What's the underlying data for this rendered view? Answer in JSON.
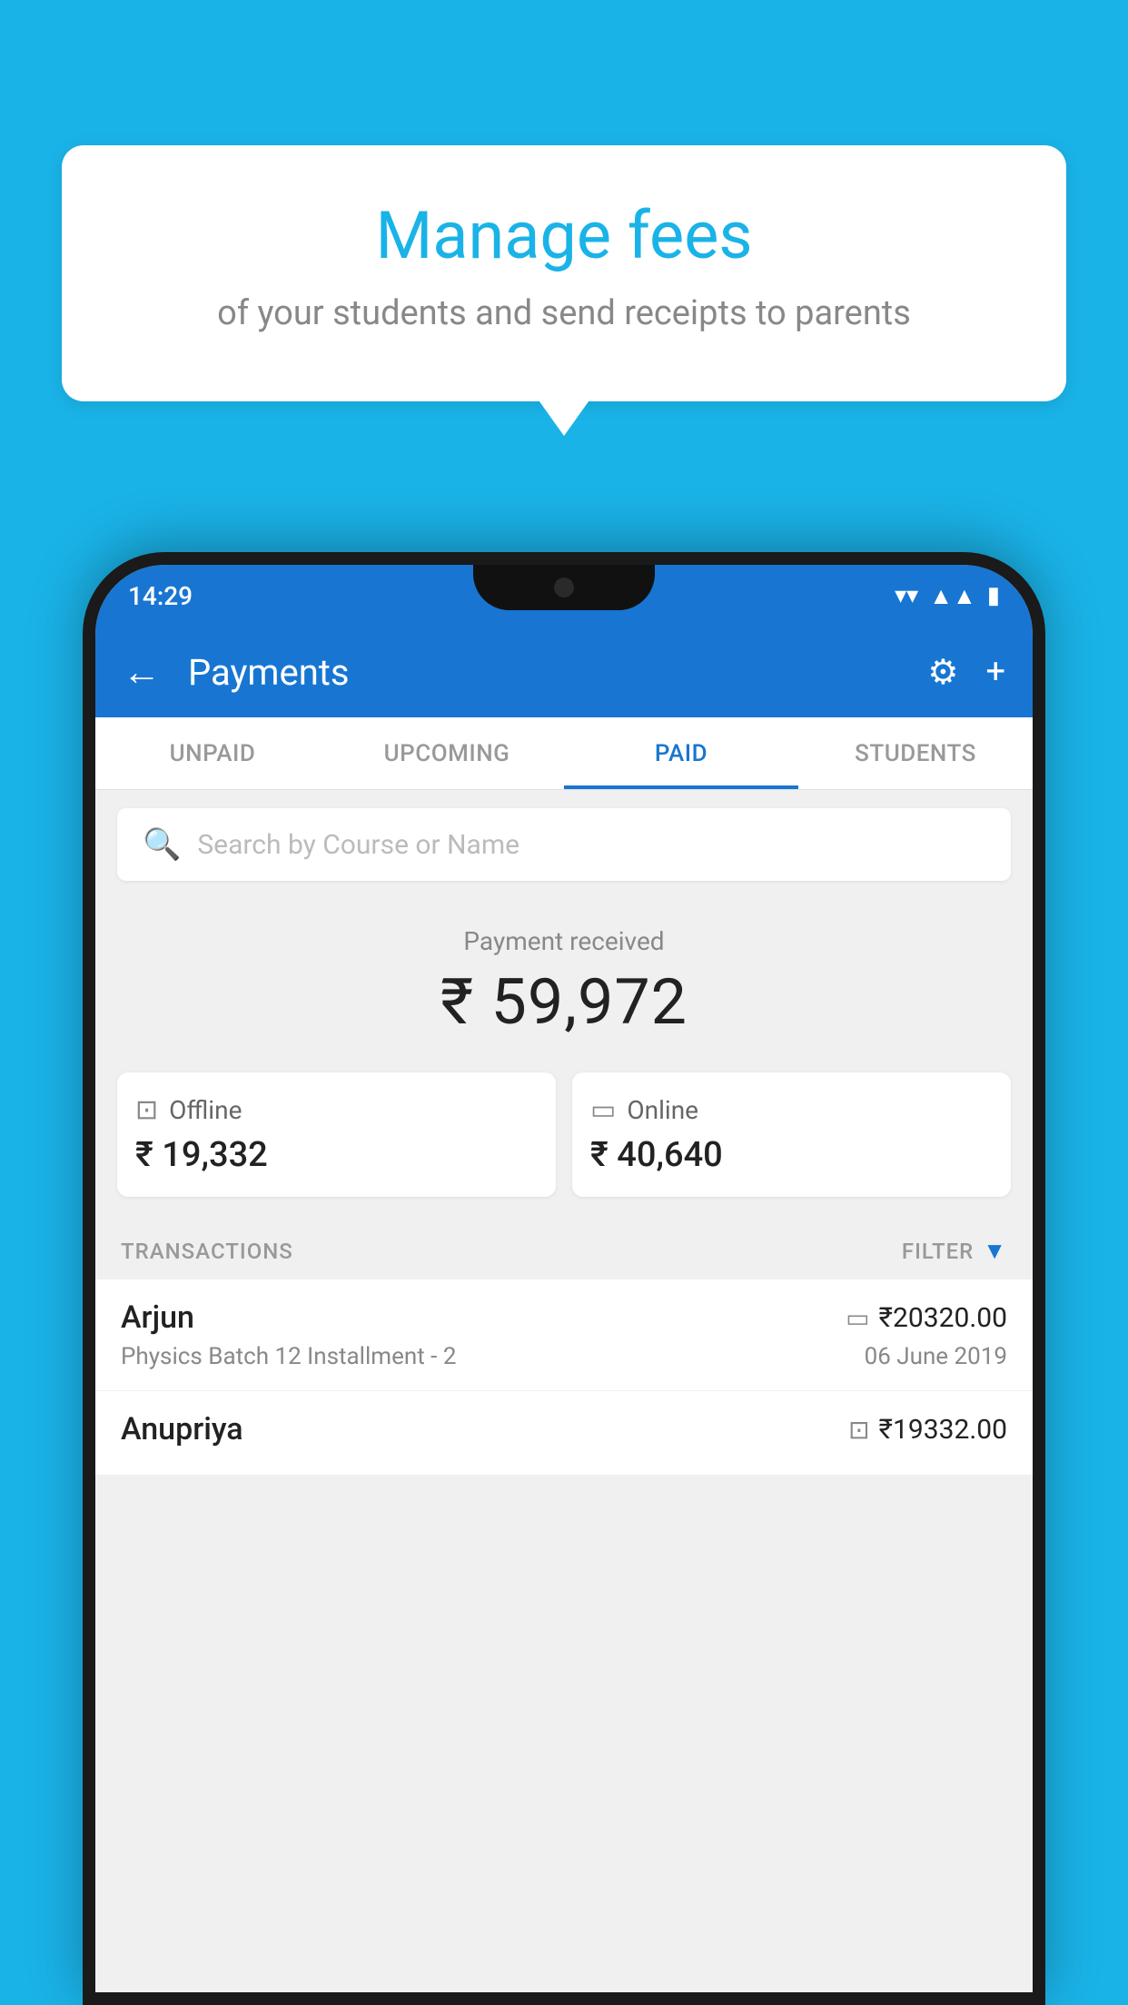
{
  "background_color": "#1ab3e8",
  "tooltip": {
    "title": "Manage fees",
    "subtitle": "of your students and send receipts to parents"
  },
  "status_bar": {
    "time": "14:29",
    "wifi": "▼",
    "signal": "▲",
    "battery": "▮"
  },
  "app_bar": {
    "title": "Payments",
    "back_icon": "←",
    "gear_icon": "⚙",
    "plus_icon": "+"
  },
  "tabs": [
    {
      "label": "UNPAID",
      "active": false
    },
    {
      "label": "UPCOMING",
      "active": false
    },
    {
      "label": "PAID",
      "active": true
    },
    {
      "label": "STUDENTS",
      "active": false
    }
  ],
  "search": {
    "placeholder": "Search by Course or Name"
  },
  "payment_received": {
    "label": "Payment received",
    "amount": "₹ 59,972"
  },
  "payment_cards": [
    {
      "icon": "offline",
      "label": "Offline",
      "amount": "₹ 19,332"
    },
    {
      "icon": "online",
      "label": "Online",
      "amount": "₹ 40,640"
    }
  ],
  "transactions_section": {
    "label": "TRANSACTIONS",
    "filter_label": "FILTER"
  },
  "transactions": [
    {
      "name": "Arjun",
      "payment_type": "card",
      "amount": "₹20320.00",
      "description": "Physics Batch 12 Installment - 2",
      "date": "06 June 2019"
    },
    {
      "name": "Anupriya",
      "payment_type": "cash",
      "amount": "₹19332.00",
      "description": "",
      "date": ""
    }
  ]
}
